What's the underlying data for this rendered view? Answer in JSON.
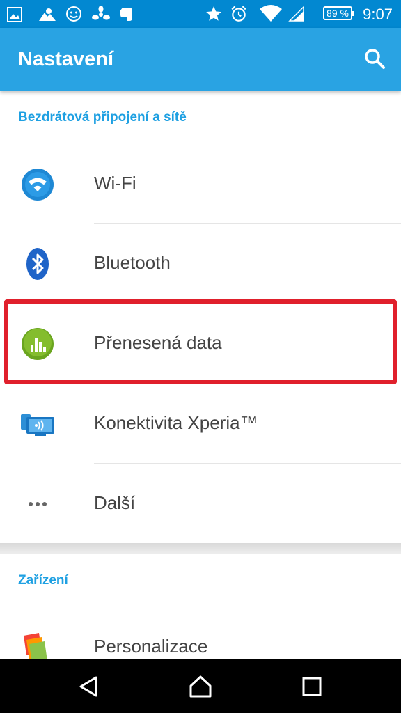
{
  "status_bar": {
    "battery": "89 %",
    "time": "9:07"
  },
  "app_bar": {
    "title": "Nastavení"
  },
  "sections": [
    {
      "header": "Bezdrátová připojení a sítě",
      "items": [
        {
          "label": "Wi-Fi",
          "icon": "wifi-icon"
        },
        {
          "label": "Bluetooth",
          "icon": "bluetooth-icon"
        },
        {
          "label": "Přenesená data",
          "icon": "data-usage-icon",
          "highlighted": true
        },
        {
          "label": "Konektivita Xperia™",
          "icon": "xperia-connectivity-icon"
        },
        {
          "label": "Další",
          "icon": "more-icon"
        }
      ]
    },
    {
      "header": "Zařízení",
      "items": [
        {
          "label": "Personalizace",
          "icon": "personalization-icon"
        }
      ]
    }
  ],
  "colors": {
    "status_bar": "#0288d1",
    "app_bar": "#29a3e3",
    "section_header": "#1ea0e2",
    "highlight": "#e0202c"
  }
}
